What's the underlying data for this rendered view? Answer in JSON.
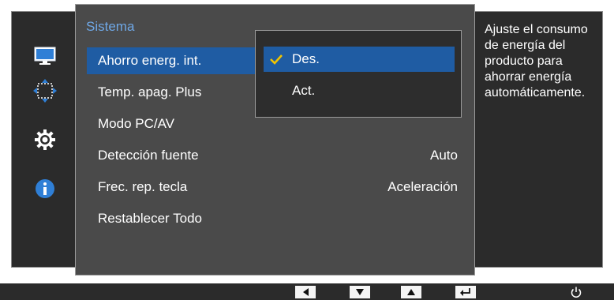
{
  "menu": {
    "title": "Sistema",
    "items": [
      {
        "label": "Ahorro energ. int.",
        "value": ""
      },
      {
        "label": "Temp. apag. Plus",
        "value": ""
      },
      {
        "label": "Modo PC/AV",
        "value": ""
      },
      {
        "label": "Detección fuente",
        "value": "Auto"
      },
      {
        "label": "Frec. rep. tecla",
        "value": "Aceleración"
      },
      {
        "label": "Restablecer Todo",
        "value": ""
      }
    ]
  },
  "submenu": {
    "options": [
      {
        "label": "Des.",
        "checked": true
      },
      {
        "label": "Act.",
        "checked": false
      }
    ]
  },
  "help": {
    "text": "Ajuste el consumo de energía del producto para ahorrar energía automáticamente."
  },
  "rail": {
    "icons": [
      "monitor-icon",
      "move-arrows-icon",
      "gear-icon",
      "info-icon"
    ]
  },
  "buttons": [
    "left-arrow-icon",
    "down-arrow-icon",
    "up-arrow-icon",
    "enter-icon",
    "power-icon"
  ],
  "colors": {
    "highlight": "#1f5ca3",
    "title": "#6fa8e6",
    "check": "#f2c400",
    "panel": "#4a4a4a",
    "rail": "#2b2b2b"
  }
}
